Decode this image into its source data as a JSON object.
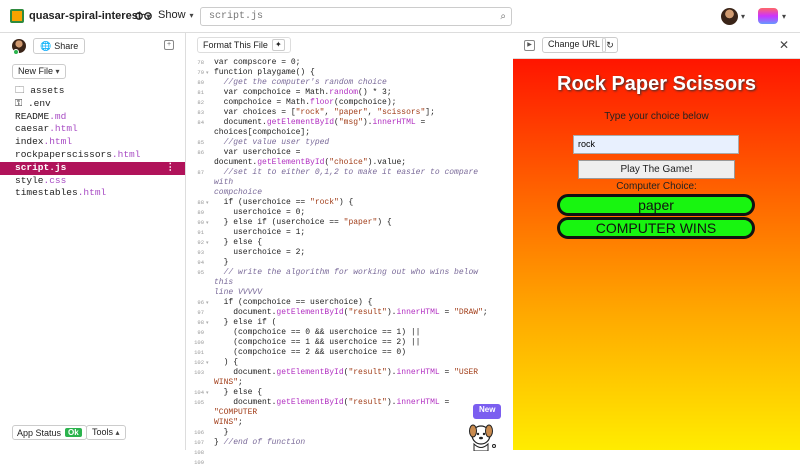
{
  "topbar": {
    "project_name": "quasar-spiral-interest",
    "show_label": "Show",
    "search_value": "script.js"
  },
  "sidebar": {
    "share_label": "Share",
    "new_file_label": "New File",
    "files": [
      {
        "name": "assets",
        "icon": "folder-icon"
      },
      {
        "name": ".env",
        "icon": "key-icon"
      },
      {
        "name": "README",
        "ext": ".md"
      },
      {
        "name": "caesar",
        "ext": ".html"
      },
      {
        "name": "index",
        "ext": ".html"
      },
      {
        "name": "rockpaperscissors",
        "ext": ".html"
      },
      {
        "name": "script.js",
        "ext": "",
        "selected": true
      },
      {
        "name": "style",
        "ext": ".css"
      },
      {
        "name": "timestables",
        "ext": ".html"
      }
    ],
    "app_status_label": "App Status",
    "app_status_badge": "Ok",
    "tools_label": "Tools"
  },
  "editor": {
    "format_label": "Format This File",
    "new_label": "New",
    "lines": [
      {
        "n": "78",
        "f": "",
        "html": "<span class='kw'>var</span> compscore = 0;"
      },
      {
        "n": "79",
        "f": "▾",
        "html": "<span class='kw'>function</span> playgame() {"
      },
      {
        "n": "80",
        "f": "",
        "html": "  <span class='cm'>//get the computer's random choice</span>"
      },
      {
        "n": "81",
        "f": "",
        "html": "  <span class='kw'>var</span> compchoice = Math.<span class='fn'>random</span>() * 3;"
      },
      {
        "n": "82",
        "f": "",
        "html": "  compchoice = Math.<span class='fn'>floor</span>(compchoice);"
      },
      {
        "n": "83",
        "f": "",
        "html": "  <span class='kw'>var</span> choices = [<span class='str'>\"rock\"</span>, <span class='str'>\"paper\"</span>, <span class='str'>\"scissors\"</span>];"
      },
      {
        "n": "84",
        "f": "",
        "html": "  document.<span class='fn'>getElementById</span>(<span class='str'>\"msg\"</span>).<span class='fn'>innerHTML</span> =\nchoices[compchoice];"
      },
      {
        "n": "85",
        "f": "",
        "html": "  <span class='cm'>//get value user typed</span>"
      },
      {
        "n": "86",
        "f": "",
        "html": "  <span class='kw'>var</span> userchoice = document.<span class='fn'>getElementById</span>(<span class='str'>\"choice\"</span>).value;"
      },
      {
        "n": "87",
        "f": "",
        "html": "  <span class='cm'>//set it to either 0,1,2 to make it easier to compare with\ncompchoice</span>"
      },
      {
        "n": "88",
        "f": "▾",
        "html": "  <span class='kw'>if</span> (userchoice == <span class='str'>\"rock\"</span>) {"
      },
      {
        "n": "89",
        "f": "",
        "html": "    userchoice = 0;"
      },
      {
        "n": "90",
        "f": "▾",
        "html": "  } <span class='kw'>else if</span> (userchoice == <span class='str'>\"paper\"</span>) {"
      },
      {
        "n": "91",
        "f": "",
        "html": "    userchoice = 1;"
      },
      {
        "n": "92",
        "f": "▾",
        "html": "  } <span class='kw'>else</span> {"
      },
      {
        "n": "93",
        "f": "",
        "html": "    userchoice = 2;"
      },
      {
        "n": "94",
        "f": "",
        "html": "  }"
      },
      {
        "n": "95",
        "f": "",
        "html": "  <span class='cm'>// write the algorithm for working out who wins below this\nline VVVVV</span>"
      },
      {
        "n": "96",
        "f": "▾",
        "html": "  <span class='kw'>if</span> (compchoice == userchoice) {"
      },
      {
        "n": "97",
        "f": "",
        "html": "    document.<span class='fn'>getElementById</span>(<span class='str'>\"result\"</span>).<span class='fn'>innerHTML</span> = <span class='str'>\"DRAW\"</span>;"
      },
      {
        "n": "98",
        "f": "▾",
        "html": "  } <span class='kw'>else if</span> ("
      },
      {
        "n": "99",
        "f": "",
        "html": "    (compchoice == 0 && userchoice == 1) ||"
      },
      {
        "n": "100",
        "f": "",
        "html": "    (compchoice == 1 && userchoice == 2) ||"
      },
      {
        "n": "101",
        "f": "",
        "html": "    (compchoice == 2 && userchoice == 0)"
      },
      {
        "n": "102",
        "f": "▾",
        "html": "  ) {"
      },
      {
        "n": "103",
        "f": "",
        "html": "    document.<span class='fn'>getElementById</span>(<span class='str'>\"result\"</span>).<span class='fn'>innerHTML</span> = <span class='str'>\"USER WINS\"</span>;"
      },
      {
        "n": "104",
        "f": "▾",
        "html": "  } <span class='kw'>else</span> {"
      },
      {
        "n": "105",
        "f": "",
        "html": "    document.<span class='fn'>getElementById</span>(<span class='str'>\"result\"</span>).<span class='fn'>innerHTML</span> = <span class='str'>\"COMPUTER\nWINS\"</span>;"
      },
      {
        "n": "106",
        "f": "",
        "html": "  }"
      },
      {
        "n": "107",
        "f": "",
        "html": "} <span class='cm'>//end of function</span>"
      },
      {
        "n": "108",
        "f": "",
        "html": ""
      },
      {
        "n": "109",
        "f": "",
        "html": ""
      }
    ]
  },
  "preview": {
    "change_url_label": "Change URL",
    "title": "Rock Paper Scissors",
    "instruction": "Type your choice below",
    "input_value": "rock",
    "play_label": "Play The Game!",
    "computer_choice_label": "Computer Choice:",
    "computer_choice": "paper",
    "result": "COMPUTER WINS"
  }
}
